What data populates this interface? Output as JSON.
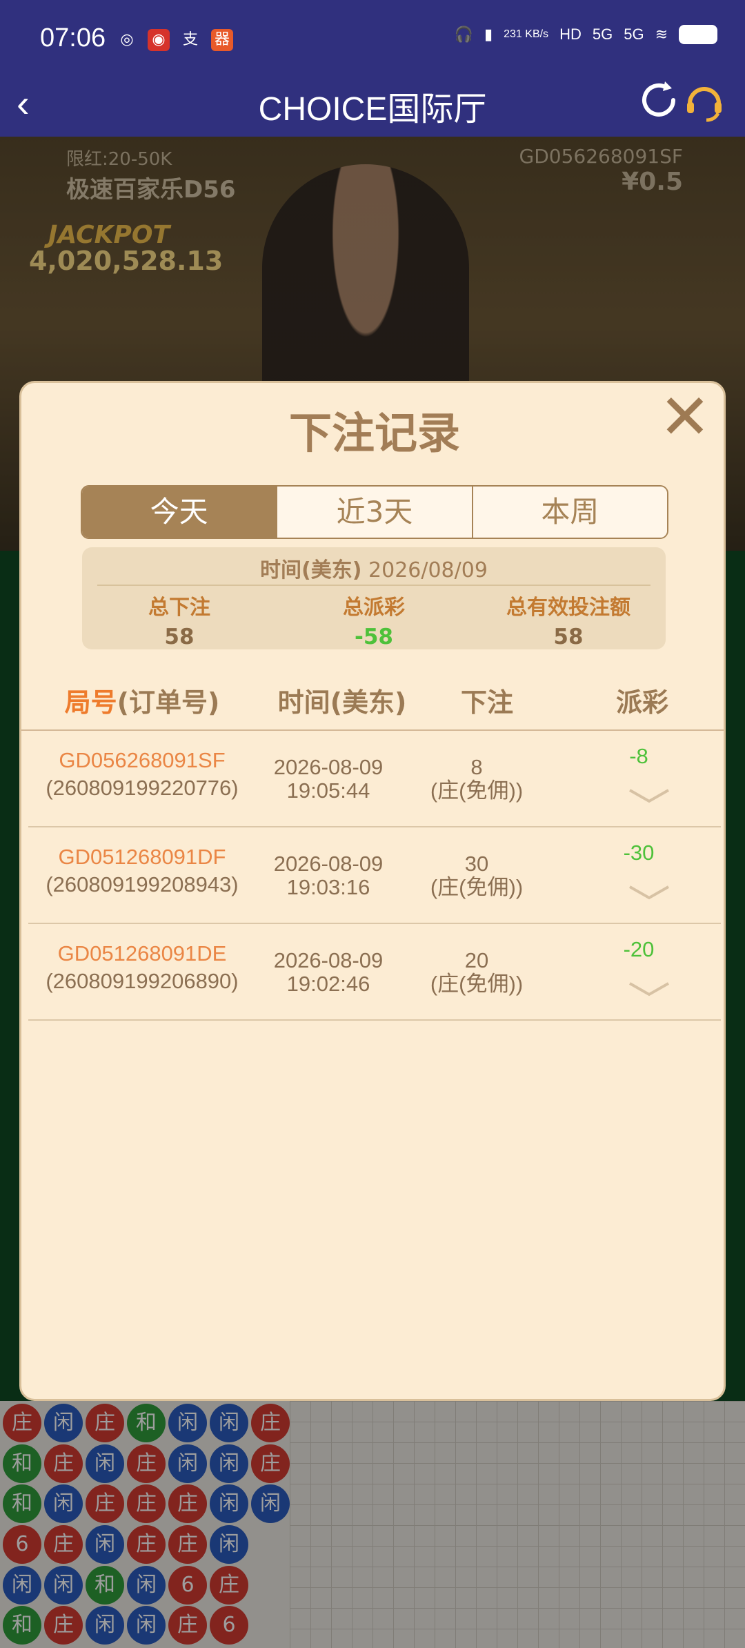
{
  "status_bar": {
    "time": "07:06",
    "net_speed": "231 KB/s",
    "signal_1": "5G",
    "signal_2": "5G"
  },
  "header": {
    "title": "CHOICE国际厅"
  },
  "game": {
    "limit_text": "限红:20-50K",
    "table_name": "极速百家乐D56",
    "round_id": "GD056268091SF",
    "chip_value": "¥0.5",
    "jackpot_label": "JACKPOT",
    "jackpot_value": "4,020,528.13"
  },
  "modal": {
    "title": "下注记录",
    "tabs": [
      {
        "label": "今天",
        "active": true
      },
      {
        "label": "近3天",
        "active": false
      },
      {
        "label": "本周",
        "active": false
      }
    ],
    "summary": {
      "time_label": "时间(美东)",
      "date": "2026/08/09",
      "total_bet_label": "总下注",
      "total_bet": "58",
      "total_payout_label": "总派彩",
      "total_payout": "-58",
      "total_valid_label": "总有效投注额",
      "total_valid": "58"
    },
    "columns": {
      "round_accent": "局号",
      "round_rest": "(订单号)",
      "time": "时间(美东)",
      "bet": "下注",
      "payout": "派彩"
    },
    "rows": [
      {
        "round": "GD056268091SF",
        "order": "(260809199220776)",
        "date": "2026-08-09",
        "time": "19:05:44",
        "amount": "8",
        "bet_type": "(庄(免佣))",
        "payout": "-8"
      },
      {
        "round": "GD051268091DF",
        "order": "(260809199208943)",
        "date": "2026-08-09",
        "time": "19:03:16",
        "amount": "30",
        "bet_type": "(庄(免佣))",
        "payout": "-30"
      },
      {
        "round": "GD051268091DE",
        "order": "(260809199206890)",
        "date": "2026-08-09",
        "time": "19:02:46",
        "amount": "20",
        "bet_type": "(庄(免佣))",
        "payout": "-20"
      }
    ]
  },
  "bead_road": [
    [
      "庄",
      "闲",
      "庄",
      "和",
      "闲",
      "闲",
      "庄"
    ],
    [
      "和",
      "庄",
      "闲",
      "庄",
      "闲",
      "闲",
      "庄"
    ],
    [
      "和",
      "闲",
      "庄",
      "庄",
      "庄",
      "闲",
      "闲"
    ],
    [
      "6",
      "庄",
      "闲",
      "庄",
      "庄",
      "闲",
      ""
    ],
    [
      "闲",
      "闲",
      "和",
      "闲",
      "6",
      "庄",
      ""
    ],
    [
      "和",
      "庄",
      "闲",
      "闲",
      "庄",
      "6",
      ""
    ]
  ],
  "colors": {
    "header_bg": "#30307e",
    "modal_bg": "#fcecd3",
    "tab_active": "#a68356",
    "accent_orange": "#ee7b2c",
    "payout_green": "#4ec13a"
  }
}
